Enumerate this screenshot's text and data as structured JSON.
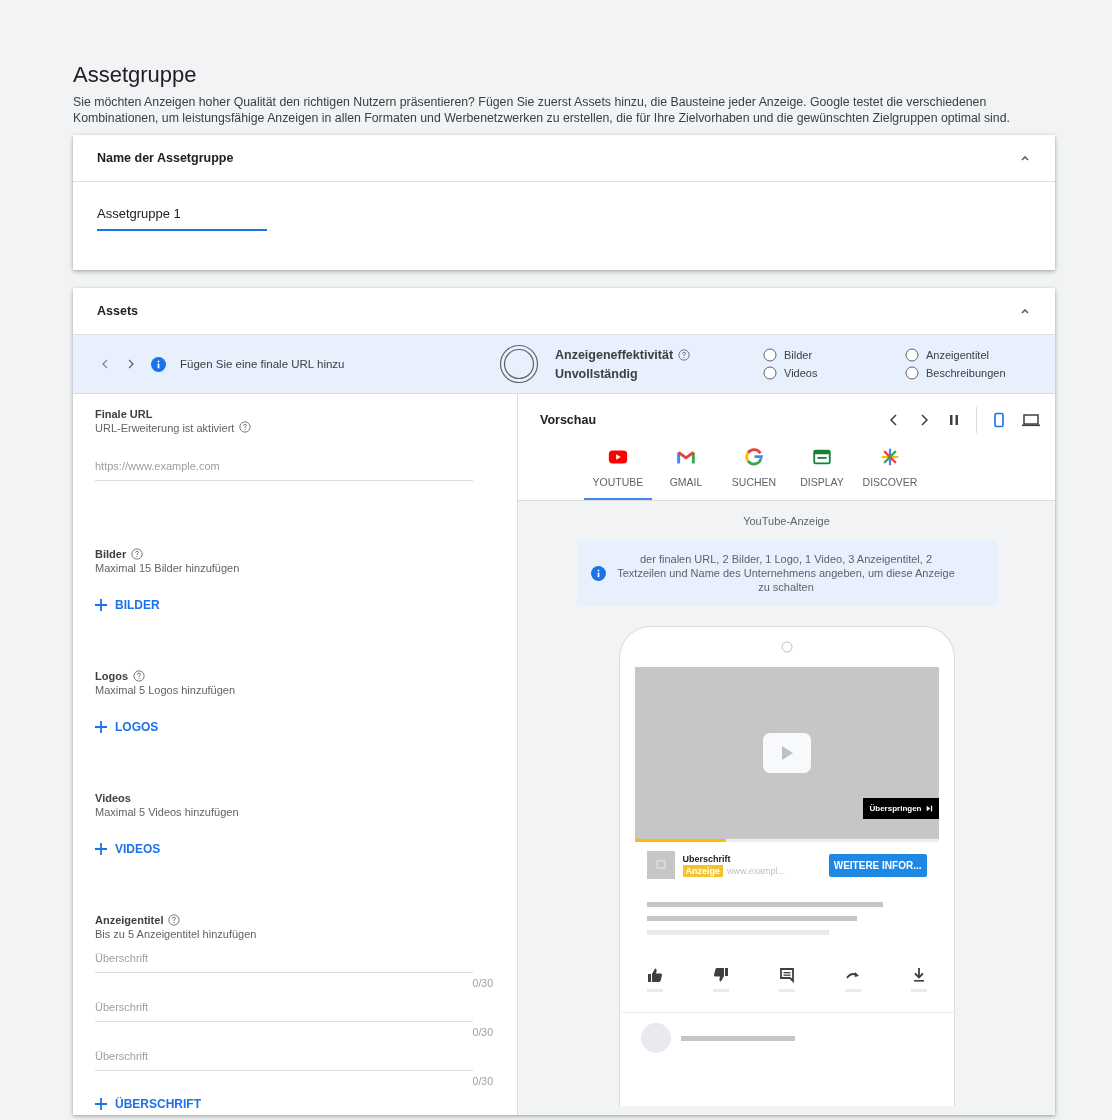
{
  "page": {
    "title": "Assetgruppe",
    "description": "Sie möchten Anzeigen hoher Qualität den richtigen Nutzern präsentieren? Fügen Sie zuerst Assets hinzu, die Bausteine jeder Anzeige. Google testet die verschiedenen Kombinationen, um leistungsfähige Anzeigen in allen Formaten und Werbenetzwerken zu erstellen, die für Ihre Zielvorhaben und die gewünschten Zielgruppen optimal sind."
  },
  "name_card": {
    "title": "Name der Assetgruppe",
    "expanded": true,
    "field": {
      "value": "Assetgruppe 1"
    }
  },
  "assets_card": {
    "title": "Assets",
    "expanded": true,
    "status_bar": {
      "message": "Fügen Sie eine finale URL hinzu",
      "effectiveness_label": "Anzeigeneffektivität",
      "effectiveness_value": "Unvollständig",
      "checklist": [
        {
          "label": "Bilder",
          "checked": false
        },
        {
          "label": "Videos",
          "checked": false
        },
        {
          "label": "Anzeigentitel",
          "checked": false
        },
        {
          "label": "Beschreibungen",
          "checked": false
        }
      ]
    },
    "sections": [
      {
        "kind": "url",
        "title": "Finale URL",
        "subtitle": "URL-Erweiterung ist aktiviert",
        "placeholder": "https://www.example.com"
      },
      {
        "kind": "add",
        "title": "Bilder",
        "help": true,
        "subtitle": "Maximal 15 Bilder hinzufügen",
        "button": "BILDER"
      },
      {
        "kind": "add",
        "title": "Logos",
        "help": true,
        "subtitle": "Maximal 5 Logos hinzufügen",
        "button": "LOGOS"
      },
      {
        "kind": "add",
        "title": "Videos",
        "help": false,
        "subtitle": "Maximal 5 Videos hinzufügen",
        "button": "VIDEOS"
      },
      {
        "kind": "headlines",
        "title": "Anzeigentitel",
        "help": true,
        "subtitle": "Bis zu 5 Anzeigentitel hinzufügen",
        "fields": [
          {
            "placeholder": "Überschrift",
            "counter": "0/30"
          },
          {
            "placeholder": "Überschrift",
            "counter": "0/30"
          },
          {
            "placeholder": "Überschrift",
            "counter": "0/30"
          }
        ],
        "button": "ÜBERSCHRIFT"
      }
    ],
    "preview": {
      "title": "Vorschau",
      "devices": [
        {
          "kind": "mobile",
          "selected": true
        },
        {
          "kind": "desktop",
          "selected": false
        }
      ],
      "tabs": [
        {
          "kind": "youtube",
          "label": "YOUTUBE",
          "selected": true
        },
        {
          "kind": "gmail",
          "label": "GMAIL",
          "selected": false
        },
        {
          "kind": "search",
          "label": "SUCHEN",
          "selected": false
        },
        {
          "kind": "display",
          "label": "DISPLAY",
          "selected": false
        },
        {
          "kind": "discover",
          "label": "DISCOVER",
          "selected": false
        }
      ],
      "ad_label": "YouTube-Anzeige",
      "notice": "der finalen URL, 2 Bilder, 1 Logo, 1 Video, 3 Anzeigentitel, 2 Textzeilen und Name des Unternehmens angeben, um diese Anzeige zu schalten",
      "progress": {
        "level": 0.3
      },
      "ad": {
        "skip": "Überspringen",
        "headline": "Uberschrift",
        "badge": "Anzeige",
        "url": "www.exampl...",
        "cta": "WEITERE INFOR..."
      }
    }
  }
}
